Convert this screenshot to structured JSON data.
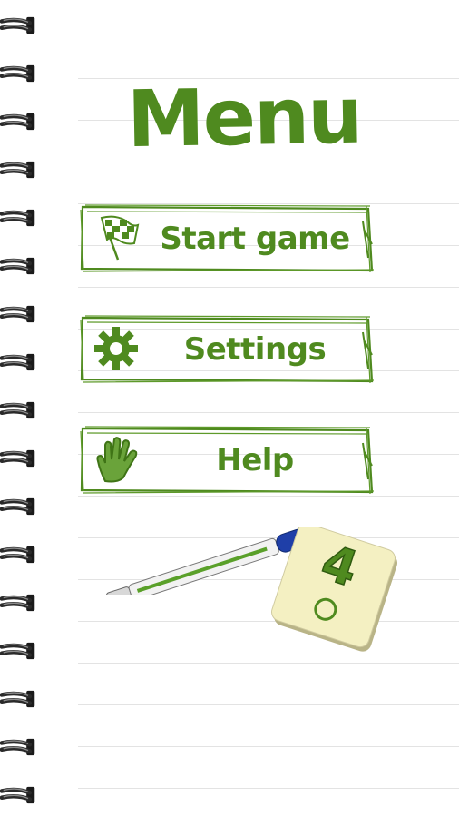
{
  "title": "Menu",
  "menu": {
    "items": [
      {
        "label": "Start game",
        "icon": "checkered-flag-icon"
      },
      {
        "label": "Settings",
        "icon": "gear-icon"
      },
      {
        "label": "Help",
        "icon": "hand-icon"
      }
    ]
  },
  "tile": {
    "number": "4"
  },
  "colors": {
    "accent": "#4f8a1f",
    "tile": "#f4f0c2",
    "pen_cap": "#1f3fa8",
    "rule": "#e3e3e3"
  }
}
